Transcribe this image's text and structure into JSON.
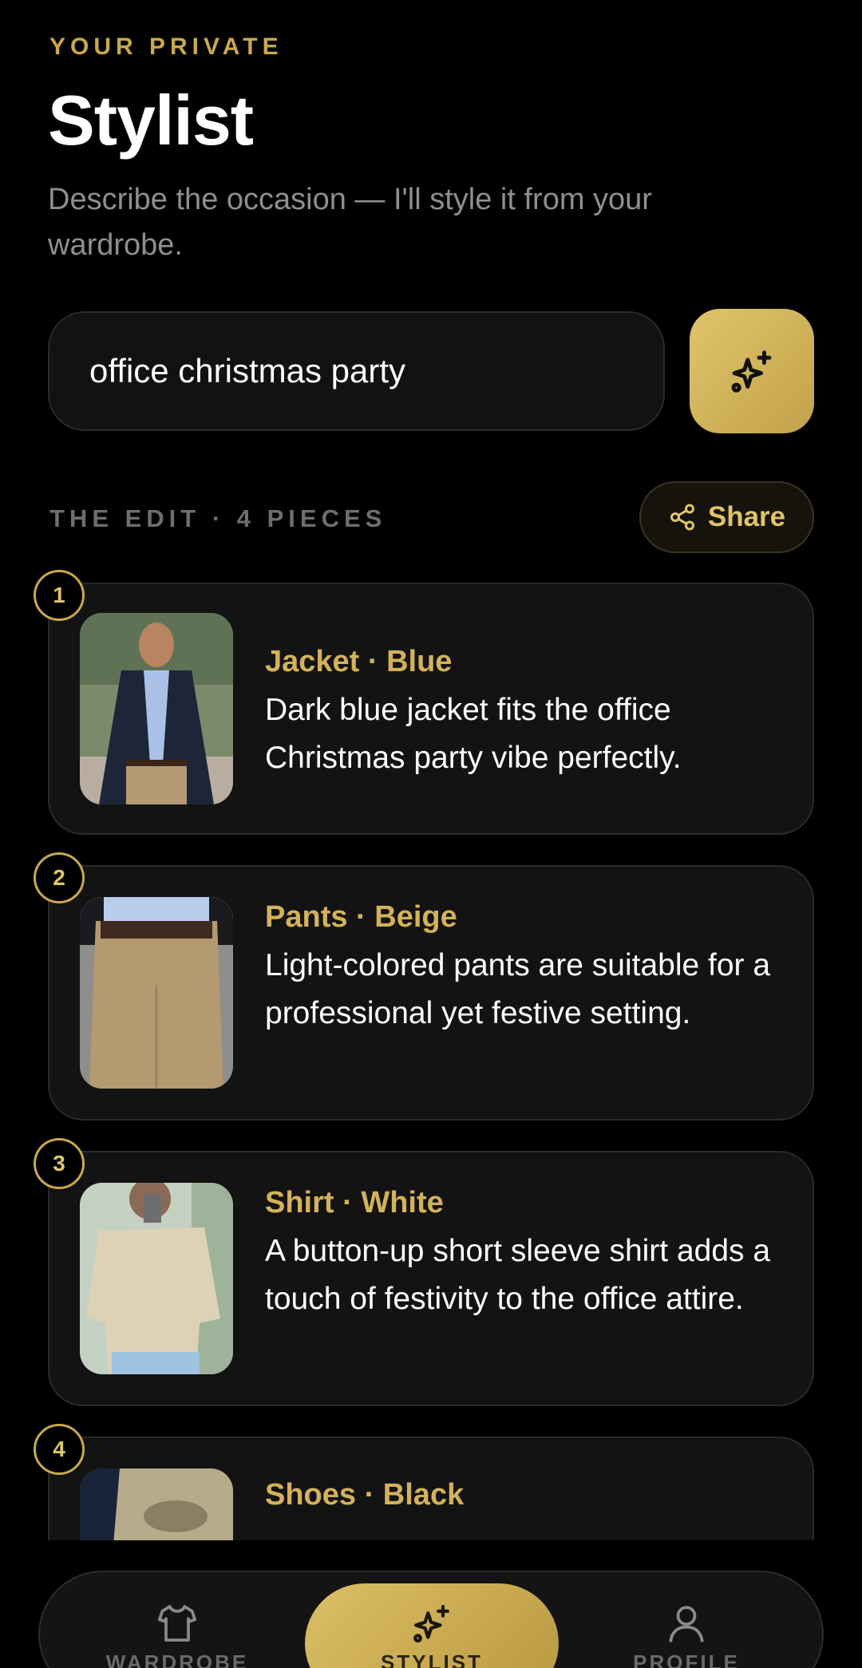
{
  "header": {
    "eyebrow": "YOUR PRIVATE",
    "title": "Stylist",
    "subtitle": "Describe the occasion — I'll style it from your wardrobe."
  },
  "search": {
    "value": "office christmas party",
    "button_icon": "sparkles-icon"
  },
  "edit": {
    "label": "THE EDIT · 4 PIECES",
    "share_label": "Share",
    "share_icon": "share-icon"
  },
  "items": [
    {
      "number": "1",
      "title": "Jacket · Blue",
      "description": "Dark blue jacket fits the office Christmas party vibe perfectly."
    },
    {
      "number": "2",
      "title": "Pants · Beige",
      "description": "Light-colored pants are suitable for a professional yet festive setting."
    },
    {
      "number": "3",
      "title": "Shirt · White",
      "description": "A button-up short sleeve shirt adds a touch of festivity to the office attire."
    },
    {
      "number": "4",
      "title": "Shoes · Black",
      "description": ""
    }
  ],
  "nav": {
    "items": [
      {
        "label": "WARDROBE",
        "icon": "shirt-icon"
      },
      {
        "label": "STYLIST",
        "icon": "sparkles-icon"
      },
      {
        "label": "PROFILE",
        "icon": "user-icon"
      }
    ]
  },
  "colors": {
    "accent": "#c9a94f",
    "background": "#000000",
    "card": "#131313"
  }
}
